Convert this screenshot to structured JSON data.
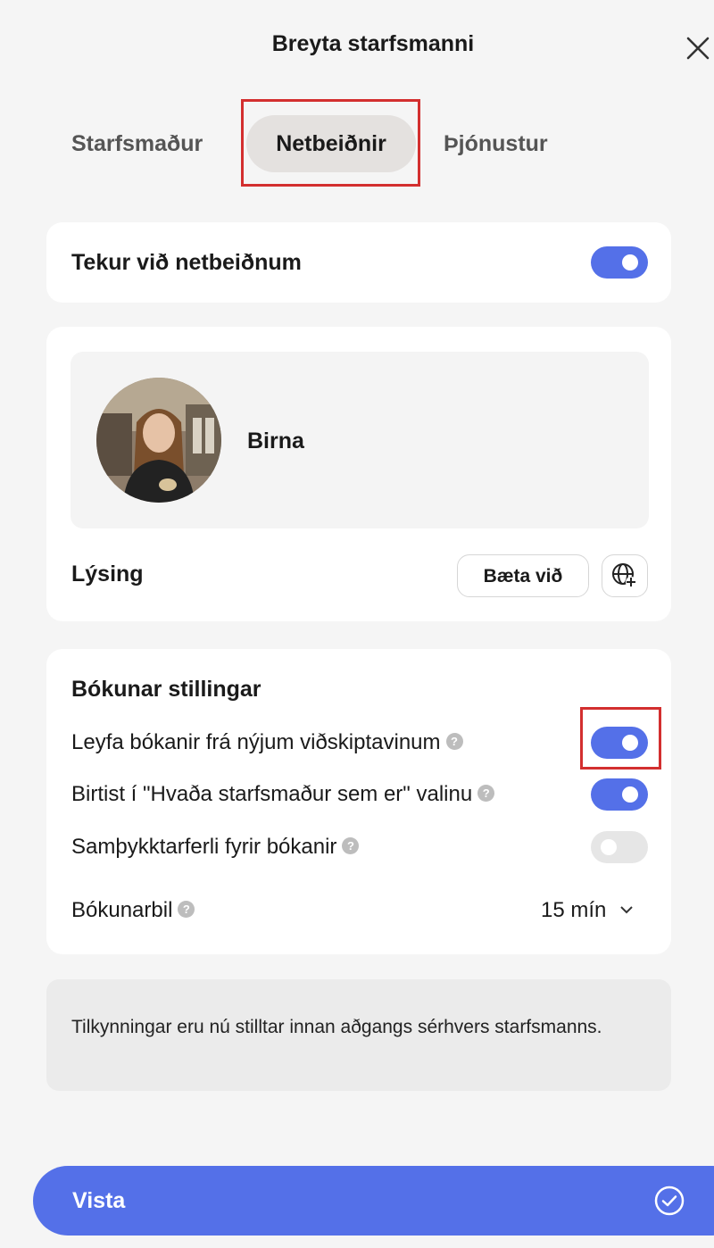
{
  "header": {
    "title": "Breyta starfsmanni",
    "close_icon": "close-icon"
  },
  "tabs": [
    {
      "label": "Starfsmaður",
      "active": false
    },
    {
      "label": "Netbeiðnir",
      "active": true
    },
    {
      "label": "Þjónustur",
      "active": false
    }
  ],
  "online_booking": {
    "label": "Tekur við netbeiðnum",
    "enabled": true
  },
  "profile": {
    "name": "Birna",
    "description_label": "Lýsing",
    "add_button_label": "Bæta við",
    "translate_icon": "globe-plus-icon"
  },
  "booking_settings": {
    "heading": "Bókunar stillingar",
    "options": [
      {
        "label": "Leyfa bókanir frá nýjum viðskiptavinum",
        "enabled": true
      },
      {
        "label": "Birtist í \"Hvaða starfsmaður sem er\" valinu",
        "enabled": true
      },
      {
        "label": "Samþykktarferli fyrir bókanir",
        "enabled": false
      }
    ],
    "interval_label": "Bókunarbil",
    "interval_value": "15 mín",
    "help_icon": "?"
  },
  "notice": {
    "text": "Tilkynningar eru nú stilltar innan aðgangs sérhvers starfsmanns."
  },
  "footer": {
    "save_label": "Vista",
    "check_icon": "check-circle-icon"
  },
  "colors": {
    "accent": "#5470e8",
    "highlight": "#d32f2f"
  }
}
